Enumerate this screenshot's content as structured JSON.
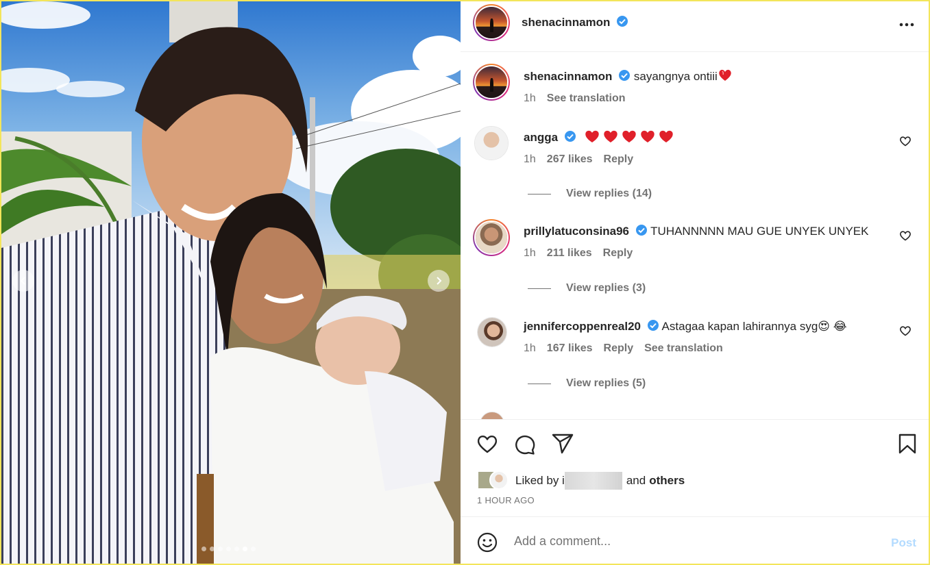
{
  "post": {
    "author": "shenacinnamon",
    "more_icon": "more-horizontal-icon",
    "carousel": {
      "total": 7,
      "active": 6
    }
  },
  "caption": {
    "username": "shenacinnamon",
    "text": "sayangnya ontiii",
    "emoji": "heart-emoji",
    "time": "1h",
    "translation": "See translation"
  },
  "comments": [
    {
      "username": "angga",
      "verified": true,
      "text": "",
      "hearts": 5,
      "time": "1h",
      "likes": "267 likes",
      "reply": "Reply",
      "view_replies": "View replies (14)"
    },
    {
      "username": "prillylatuconsina96",
      "verified": true,
      "text": "TUHANNNNN MAU GUE UNYEK UNYEK",
      "time": "1h",
      "likes": "211 likes",
      "reply": "Reply",
      "view_replies": "View replies (3)"
    },
    {
      "username": "jennifercoppenreal20",
      "verified": true,
      "text": "Astagaa kapan lahirannya syg😍 😂",
      "time": "1h",
      "likes": "167 likes",
      "reply": "Reply",
      "translation": "See translation",
      "view_replies": "View replies (5)"
    }
  ],
  "actions": {
    "like_icon": "heart-icon",
    "comment_icon": "comment-icon",
    "share_icon": "send-icon",
    "save_icon": "bookmark-icon"
  },
  "likes": {
    "prefix": "Liked by i",
    "joiner": "and",
    "others": "others"
  },
  "time_ago": "1 HOUR AGO",
  "add_comment": {
    "placeholder": "Add a comment...",
    "post_label": "Post",
    "emoji_icon": "smiley-icon"
  },
  "colors": {
    "verified": "#3897f0",
    "heart_red": "#e0202a",
    "post_disabled": "#b3dbff",
    "muted_text": "#737373"
  }
}
